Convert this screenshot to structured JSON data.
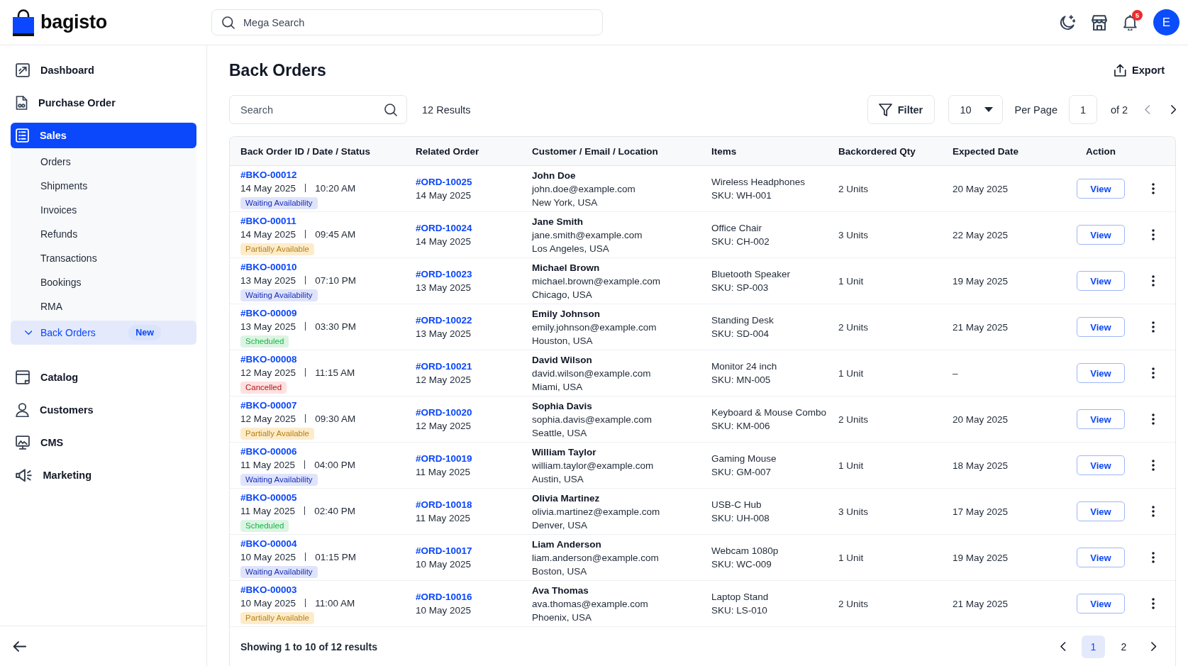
{
  "app": {
    "logo": "bagisto"
  },
  "header": {
    "search_placeholder": "Mega Search",
    "notifications": "5",
    "avatar": "E"
  },
  "sidebar": {
    "items": [
      {
        "label": "Dashboard",
        "selected": false
      },
      {
        "label": "Purchase Order",
        "selected": false
      },
      {
        "label": "Sales",
        "selected": true,
        "children": [
          {
            "label": "Orders",
            "selected": false
          },
          {
            "label": "Shipments",
            "selected": false
          },
          {
            "label": "Invoices",
            "selected": false
          },
          {
            "label": "Refunds",
            "selected": false
          },
          {
            "label": "Transactions",
            "selected": false
          },
          {
            "label": "Bookings",
            "selected": false
          },
          {
            "label": "RMA",
            "selected": false
          },
          {
            "label": "Back Orders",
            "selected": true,
            "expanded": true,
            "badge": "New"
          }
        ]
      },
      {
        "label": "Catalog",
        "selected": false
      },
      {
        "label": "Customers",
        "selected": false
      },
      {
        "label": "CMS",
        "selected": false
      },
      {
        "label": "Marketing",
        "selected": false
      }
    ]
  },
  "page": {
    "title": "Back Orders",
    "export": "Export"
  },
  "toolbar": {
    "search_placeholder": "Search",
    "results": "12 Results",
    "filter": "Filter",
    "per_page_value": "10",
    "per_page_label": "Per Page",
    "page_value": "1",
    "page_total": "of 2",
    "prev": {
      "disabled": true
    },
    "next": {
      "disabled": false
    }
  },
  "table": {
    "columns": [
      "Back Order ID / Date / Status",
      "Related Order",
      "Customer / Email / Location",
      "Items",
      "Backordered Qty",
      "Expected Date",
      "Action"
    ],
    "rows": [
      {
        "id": "#BKO-00012",
        "date": "14 May 2025",
        "time": "10:20 AM",
        "status": {
          "label": "Waiting Availability",
          "color": "#e0e4fb"
        },
        "order": "#ORD-10025",
        "order_date": "14 May 2025",
        "customer": "John Doe",
        "email": "john.doe@example.com",
        "location": "New York, USA",
        "item": "Wireless Headphones",
        "sku": "SKU: WH-001",
        "qty": "2 Units",
        "expected": "20 May 2025",
        "action": "View"
      },
      {
        "id": "#BKO-00011",
        "date": "14 May 2025",
        "time": "09:45 AM",
        "status": {
          "label": "Partially Available",
          "color": "#fdeccb"
        },
        "order": "#ORD-10024",
        "order_date": "14 May 2025",
        "customer": "Jane Smith",
        "email": "jane.smith@example.com",
        "location": "Los Angeles, USA",
        "item": "Office Chair",
        "sku": "SKU: CH-002",
        "qty": "3 Units",
        "expected": "22 May 2025",
        "action": "View"
      },
      {
        "id": "#BKO-00010",
        "date": "13 May 2025",
        "time": "07:10 PM",
        "status": {
          "label": "Waiting Availability",
          "color": "#e0e4fb"
        },
        "order": "#ORD-10023",
        "order_date": "13 May 2025",
        "customer": "Michael Brown",
        "email": "michael.brown@example.com",
        "location": "Chicago, USA",
        "item": "Bluetooth Speaker",
        "sku": "SKU: SP-003",
        "qty": "1 Unit",
        "expected": "19 May 2025",
        "action": "View"
      },
      {
        "id": "#BKO-00009",
        "date": "13 May 2025",
        "time": "03:30 PM",
        "status": {
          "label": "Scheduled",
          "color": "#dcf4e3"
        },
        "order": "#ORD-10022",
        "order_date": "13 May 2025",
        "customer": "Emily Johnson",
        "email": "emily.johnson@example.com",
        "location": "Houston, USA",
        "item": "Standing Desk",
        "sku": "SKU: SD-004",
        "qty": "2 Units",
        "expected": "21 May 2025",
        "action": "View"
      },
      {
        "id": "#BKO-00008",
        "date": "12 May 2025",
        "time": "11:15 AM",
        "status": {
          "label": "Cancelled",
          "color": "#fde1e1"
        },
        "order": "#ORD-10021",
        "order_date": "12 May 2025",
        "customer": "David Wilson",
        "email": "david.wilson@example.com",
        "location": "Miami, USA",
        "item": "Monitor 24 inch",
        "sku": "SKU: MN-005",
        "qty": "1 Unit",
        "expected": "–",
        "action": "View"
      },
      {
        "id": "#BKO-00007",
        "date": "12 May 2025",
        "time": "09:30 AM",
        "status": {
          "label": "Partially Available",
          "color": "#fdeccb"
        },
        "order": "#ORD-10020",
        "order_date": "12 May 2025",
        "customer": "Sophia Davis",
        "email": "sophia.davis@example.com",
        "location": "Seattle, USA",
        "item": "Keyboard & Mouse Combo",
        "sku": "SKU: KM-006",
        "qty": "2 Units",
        "expected": "20 May 2025",
        "action": "View"
      },
      {
        "id": "#BKO-00006",
        "date": "11 May 2025",
        "time": "04:00 PM",
        "status": {
          "label": "Waiting Availability",
          "color": "#e0e4fb"
        },
        "order": "#ORD-10019",
        "order_date": "11 May 2025",
        "customer": "William Taylor",
        "email": "william.taylor@example.com",
        "location": "Austin, USA",
        "item": "Gaming Mouse",
        "sku": "SKU: GM-007",
        "qty": "1 Unit",
        "expected": "18 May 2025",
        "action": "View"
      },
      {
        "id": "#BKO-00005",
        "date": "11 May 2025",
        "time": "02:40 PM",
        "status": {
          "label": "Scheduled",
          "color": "#dcf4e3"
        },
        "order": "#ORD-10018",
        "order_date": "11 May 2025",
        "customer": "Olivia Martinez",
        "email": "olivia.martinez@example.com",
        "location": "Denver, USA",
        "item": "USB-C Hub",
        "sku": "SKU: UH-008",
        "qty": "3 Units",
        "expected": "17 May 2025",
        "action": "View"
      },
      {
        "id": "#BKO-00004",
        "date": "10 May 2025",
        "time": "01:15 PM",
        "status": {
          "label": "Waiting Availability",
          "color": "#e0e4fb"
        },
        "order": "#ORD-10017",
        "order_date": "10 May 2025",
        "customer": "Liam Anderson",
        "email": "liam.anderson@example.com",
        "location": "Boston, USA",
        "item": "Webcam 1080p",
        "sku": "SKU: WC-009",
        "qty": "1 Unit",
        "expected": "19 May 2025",
        "action": "View"
      },
      {
        "id": "#BKO-00003",
        "date": "10 May 2025",
        "time": "11:00 AM",
        "status": {
          "label": "Partially Available",
          "color": "#fdeccb"
        },
        "order": "#ORD-10016",
        "order_date": "10 May 2025",
        "customer": "Ava Thomas",
        "email": "ava.thomas@example.com",
        "location": "Phoenix, USA",
        "item": "Laptop Stand",
        "sku": "SKU: LS-010",
        "qty": "2 Units",
        "expected": "21 May 2025",
        "action": "View"
      }
    ]
  },
  "footer": {
    "summary": "Showing 1 to 10 of 12 results",
    "pages": [
      {
        "label": "1",
        "selected": true
      },
      {
        "label": "2",
        "selected": false
      }
    ]
  }
}
